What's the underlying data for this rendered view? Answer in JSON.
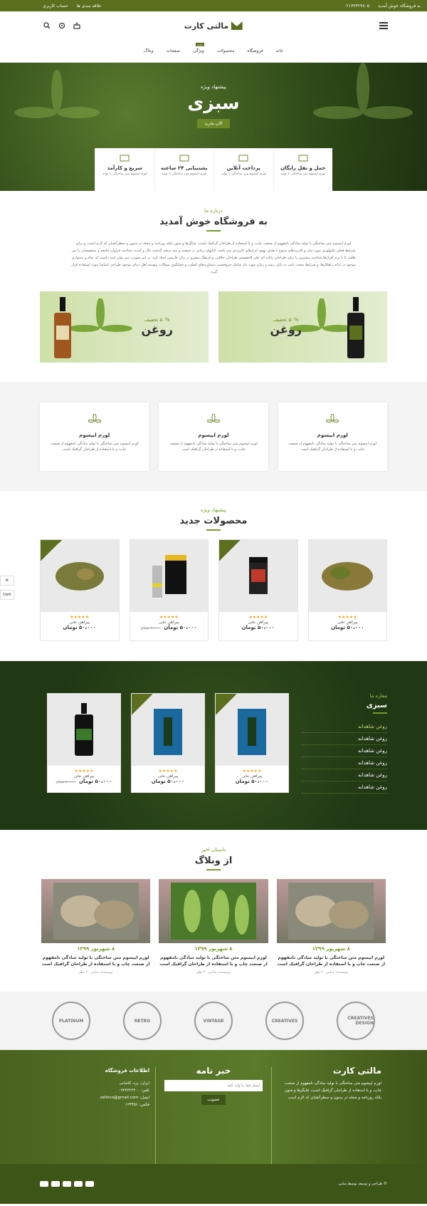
{
  "topbar": {
    "welcome": "به فروشگاه خوش آمدید",
    "phone": "۰۲۱۳۲۴۲۳۸۰۵",
    "wishlist": "علاقه مندی ها",
    "account": "حساب کاربری"
  },
  "header": {
    "brand": "مالتی کارت"
  },
  "nav": [
    "خانه",
    "فروشگاه",
    "محصولات",
    "ویژگی",
    "صفحات",
    "وبلاگ"
  ],
  "nav_badge": "جدید",
  "hero": {
    "sub": "پیشنهاد ویژه",
    "title": "سبزی",
    "cta": "الان بخرید"
  },
  "features": [
    {
      "title": "حمل و نقل رایگان",
      "desc": "لورم ایپسوم متن ساختگی با تولید"
    },
    {
      "title": "پرداخت آنلاین",
      "desc": "لورم ایپسوم متن ساختگی با تولید"
    },
    {
      "title": "پشتیبانی ۲۴ ساعته",
      "desc": "لورم ایپسوم متن ساختگی با تولید"
    },
    {
      "title": "سریع و کارآمد",
      "desc": "لورم ایپسوم متن ساختگی با تولید"
    }
  ],
  "about": {
    "kicker": "درباره ما",
    "title": "به فروشگاه خوش آمدید",
    "text": "لورم ایپسوم متن ساختگی با تولید سادگی نامفهوم از صنعت چاپ، و با استفاده از طراحان گرافیک است، چاپگرها و متون بلکه روزنامه و مجله در ستون و سطرآنچنان که لازم است، و برای شرایط فعلی تکنولوژی مورد نیاز، و کاربردهای متنوع با هدف بهبود ابزارهای کاربردی می باشد، کتابهای زیادی در شصت و سه درصد گذشته حال و آینده، شناخت فراوان جامعه و متخصصان را می طلبد، تا با نرم افزارها شناخت بیشتری را برای طراحان رایانه ای علی الخصوص طراحان خلاقی، و فرهنگ پیشرو در زبان فارسی ایجاد کرد، در این صورت می توان امید داشت که تمام و دشواری موجود در ارائه راهکارها، و شرایط سخت تایپ به پایان رسد و زمان مورد نیاز شامل حروفچینی دستاوردهای اصلی، و جوابگوی سوالات پیوسته اهل دنیای موجود طراحی اساسا مورد استفاده قرار گیرد."
  },
  "banners": [
    {
      "discount": "۵۰% تخفیف",
      "name": "روغن"
    },
    {
      "discount": "۵۰% تخفیف",
      "name": "روغن"
    }
  ],
  "services": [
    {
      "title": "لورم ایپسوم",
      "desc": "لورم ایپسوم متن ساختگی با تولید سادگی نامفهوم از صنعت چاپ، و با استفاده از طراحان گرافیک است"
    },
    {
      "title": "لورم ایپسوم",
      "desc": "لورم ایپسوم متن ساختگی با تولید سادگی نامفهوم از صنعت چاپ، و با استفاده از طراحان گرافیک است"
    },
    {
      "title": "لورم ایپسوم",
      "desc": "لورم ایپسوم متن ساختگی با تولید سادگی نامفهوم از صنعت چاپ، و با استفاده از طراحان گرافیک است"
    }
  ],
  "new_products": {
    "kicker": "پیشنهاد ویژه",
    "title": "محصولات جدید",
    "items": [
      {
        "name": "پیراهن نخی",
        "price": "۵۰،۰۰۰ تومان",
        "old": "",
        "sale": false
      },
      {
        "name": "پیراهن نخی",
        "price": "۵۰،۰۰۰ تومان",
        "old": "",
        "sale": true
      },
      {
        "name": "پیراهن نخی",
        "price": "۵۰،۰۰۰ تومان",
        "old": "۷۰،۰۰۰ تومان",
        "sale": false
      },
      {
        "name": "پیراهن نخی",
        "price": "۵۰،۰۰۰ تومان",
        "old": "",
        "sale": true
      }
    ]
  },
  "shop": {
    "kicker": "مغازه ما",
    "title": "سبزی",
    "menu": [
      "روغن شاهدانه",
      "روغن شاهدانه",
      "روغن شاهدانه",
      "روغن شاهدانه",
      "روغن شاهدانه",
      "روغن شاهدانه"
    ],
    "items": [
      {
        "name": "پیراهن نخی",
        "price": "۵۰،۰۰۰ تومان",
        "old": ""
      },
      {
        "name": "پیراهن نخی",
        "price": "۵۰،۰۰۰ تومان",
        "old": ""
      },
      {
        "name": "پیراهن نخی",
        "price": "۵۰،۰۰۰ تومان",
        "old": "۷۰،۰۰۰ تومان"
      }
    ]
  },
  "blog": {
    "kicker": "داستان اخیر",
    "title": "از وبلاگ",
    "posts": [
      {
        "date": "۸ شهریور ۱۳۹۹",
        "title": "لورم ایپسوم متن ساختگی با تولید سادگی نامفهوم از صنعت چاپ و با استفاده از طراحان گرافیک است",
        "meta": "نویسنده: سایبر ۲۰ نظر"
      },
      {
        "date": "۸ شهریور ۱۳۹۹",
        "title": "لورم ایپسوم متن ساختگی با تولید سادگی نامفهوم از صنعت چاپ و با استفاده از طراحان گرافیک است",
        "meta": "نویسنده: سایبر ۲۰ نظر"
      },
      {
        "date": "۸ شهریور ۱۳۹۹",
        "title": "لورم ایپسوم متن ساختگی با تولید سادگی نامفهوم از صنعت چاپ و با استفاده از طراحان گرافیک است",
        "meta": "نویسنده: سایبر ۲۰ نظر"
      }
    ]
  },
  "brands": [
    "CREATIVES DESIGN",
    "CREATIVES",
    "VINTAGE",
    "RETRO",
    "PLATINUM"
  ],
  "footer": {
    "brand": "مالتی کارت",
    "about": "لورم ایپسوم متن ساختگی با تولید سادگی نامفهوم از صنعت چاپ، و با استفاده از طراحان گرافیک است، چاپگرها و متون بلکه روزنامه و مجله در ستون و سطرآنچنان که لازم است",
    "newsletter_title": "خبر نامه",
    "newsletter_placeholder": "ایمیل خود را وارد کنید",
    "newsletter_btn": "عضویت",
    "info_title": "اطلاعات فروشگاه",
    "info": [
      "ایران، یزد، کاشانی",
      "تلفن: ۰۹۳۷۲۲۲۲۰۰",
      "ایمیل: selinco@gmail.com",
      "فکس: ۱۲۳۴۵۶"
    ],
    "copyright": "© طراحی و توسعه توسط سایبر"
  },
  "colors": {
    "accent": "#5b6f1e",
    "light_accent": "#7a9a2a"
  }
}
